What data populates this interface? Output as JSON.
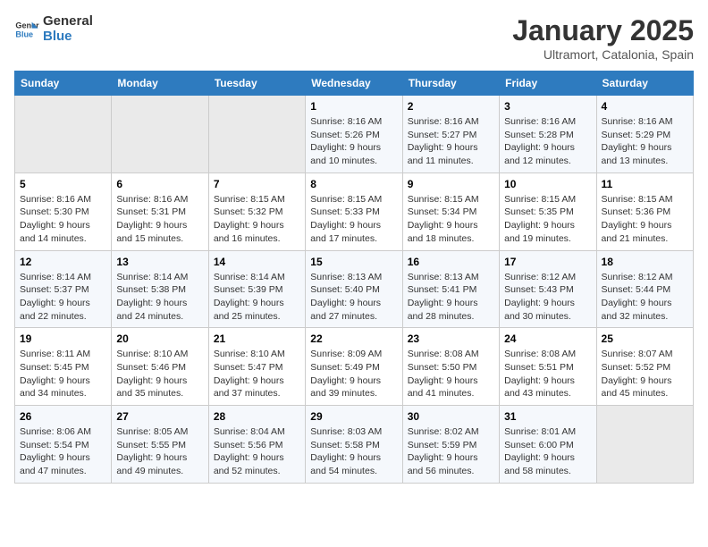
{
  "logo": {
    "line1": "General",
    "line2": "Blue"
  },
  "title": "January 2025",
  "subtitle": "Ultramort, Catalonia, Spain",
  "weekdays": [
    "Sunday",
    "Monday",
    "Tuesday",
    "Wednesday",
    "Thursday",
    "Friday",
    "Saturday"
  ],
  "weeks": [
    [
      {
        "day": "",
        "empty": true
      },
      {
        "day": "",
        "empty": true
      },
      {
        "day": "",
        "empty": true
      },
      {
        "day": "1",
        "sunrise": "8:16 AM",
        "sunset": "5:26 PM",
        "daylight": "9 hours and 10 minutes."
      },
      {
        "day": "2",
        "sunrise": "8:16 AM",
        "sunset": "5:27 PM",
        "daylight": "9 hours and 11 minutes."
      },
      {
        "day": "3",
        "sunrise": "8:16 AM",
        "sunset": "5:28 PM",
        "daylight": "9 hours and 12 minutes."
      },
      {
        "day": "4",
        "sunrise": "8:16 AM",
        "sunset": "5:29 PM",
        "daylight": "9 hours and 13 minutes."
      }
    ],
    [
      {
        "day": "5",
        "sunrise": "8:16 AM",
        "sunset": "5:30 PM",
        "daylight": "9 hours and 14 minutes."
      },
      {
        "day": "6",
        "sunrise": "8:16 AM",
        "sunset": "5:31 PM",
        "daylight": "9 hours and 15 minutes."
      },
      {
        "day": "7",
        "sunrise": "8:15 AM",
        "sunset": "5:32 PM",
        "daylight": "9 hours and 16 minutes."
      },
      {
        "day": "8",
        "sunrise": "8:15 AM",
        "sunset": "5:33 PM",
        "daylight": "9 hours and 17 minutes."
      },
      {
        "day": "9",
        "sunrise": "8:15 AM",
        "sunset": "5:34 PM",
        "daylight": "9 hours and 18 minutes."
      },
      {
        "day": "10",
        "sunrise": "8:15 AM",
        "sunset": "5:35 PM",
        "daylight": "9 hours and 19 minutes."
      },
      {
        "day": "11",
        "sunrise": "8:15 AM",
        "sunset": "5:36 PM",
        "daylight": "9 hours and 21 minutes."
      }
    ],
    [
      {
        "day": "12",
        "sunrise": "8:14 AM",
        "sunset": "5:37 PM",
        "daylight": "9 hours and 22 minutes."
      },
      {
        "day": "13",
        "sunrise": "8:14 AM",
        "sunset": "5:38 PM",
        "daylight": "9 hours and 24 minutes."
      },
      {
        "day": "14",
        "sunrise": "8:14 AM",
        "sunset": "5:39 PM",
        "daylight": "9 hours and 25 minutes."
      },
      {
        "day": "15",
        "sunrise": "8:13 AM",
        "sunset": "5:40 PM",
        "daylight": "9 hours and 27 minutes."
      },
      {
        "day": "16",
        "sunrise": "8:13 AM",
        "sunset": "5:41 PM",
        "daylight": "9 hours and 28 minutes."
      },
      {
        "day": "17",
        "sunrise": "8:12 AM",
        "sunset": "5:43 PM",
        "daylight": "9 hours and 30 minutes."
      },
      {
        "day": "18",
        "sunrise": "8:12 AM",
        "sunset": "5:44 PM",
        "daylight": "9 hours and 32 minutes."
      }
    ],
    [
      {
        "day": "19",
        "sunrise": "8:11 AM",
        "sunset": "5:45 PM",
        "daylight": "9 hours and 34 minutes."
      },
      {
        "day": "20",
        "sunrise": "8:10 AM",
        "sunset": "5:46 PM",
        "daylight": "9 hours and 35 minutes."
      },
      {
        "day": "21",
        "sunrise": "8:10 AM",
        "sunset": "5:47 PM",
        "daylight": "9 hours and 37 minutes."
      },
      {
        "day": "22",
        "sunrise": "8:09 AM",
        "sunset": "5:49 PM",
        "daylight": "9 hours and 39 minutes."
      },
      {
        "day": "23",
        "sunrise": "8:08 AM",
        "sunset": "5:50 PM",
        "daylight": "9 hours and 41 minutes."
      },
      {
        "day": "24",
        "sunrise": "8:08 AM",
        "sunset": "5:51 PM",
        "daylight": "9 hours and 43 minutes."
      },
      {
        "day": "25",
        "sunrise": "8:07 AM",
        "sunset": "5:52 PM",
        "daylight": "9 hours and 45 minutes."
      }
    ],
    [
      {
        "day": "26",
        "sunrise": "8:06 AM",
        "sunset": "5:54 PM",
        "daylight": "9 hours and 47 minutes."
      },
      {
        "day": "27",
        "sunrise": "8:05 AM",
        "sunset": "5:55 PM",
        "daylight": "9 hours and 49 minutes."
      },
      {
        "day": "28",
        "sunrise": "8:04 AM",
        "sunset": "5:56 PM",
        "daylight": "9 hours and 52 minutes."
      },
      {
        "day": "29",
        "sunrise": "8:03 AM",
        "sunset": "5:58 PM",
        "daylight": "9 hours and 54 minutes."
      },
      {
        "day": "30",
        "sunrise": "8:02 AM",
        "sunset": "5:59 PM",
        "daylight": "9 hours and 56 minutes."
      },
      {
        "day": "31",
        "sunrise": "8:01 AM",
        "sunset": "6:00 PM",
        "daylight": "9 hours and 58 minutes."
      },
      {
        "day": "",
        "empty": true
      }
    ]
  ],
  "labels": {
    "sunrise": "Sunrise:",
    "sunset": "Sunset:",
    "daylight": "Daylight:"
  }
}
